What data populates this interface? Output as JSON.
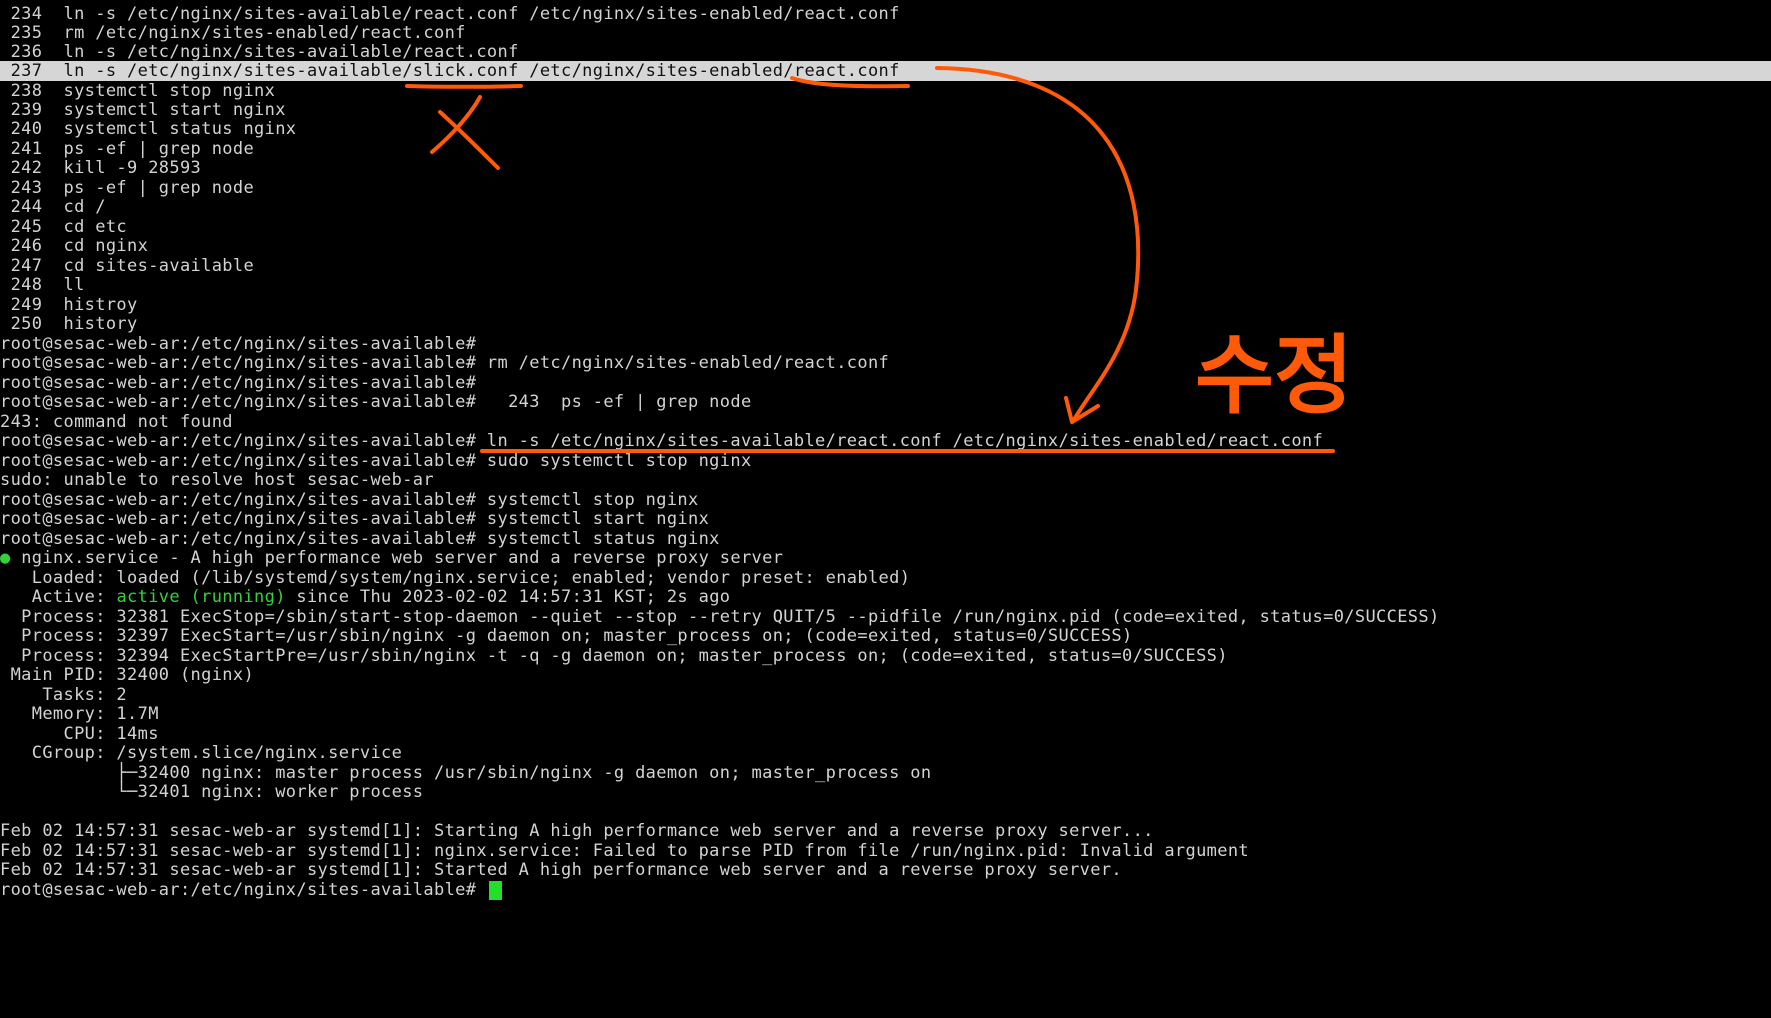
{
  "terminal": {
    "lines": [
      " 234  ln -s /etc/nginx/sites-available/react.conf /etc/nginx/sites-enabled/react.conf",
      " 235  rm /etc/nginx/sites-enabled/react.conf",
      " 236  ln -s /etc/nginx/sites-available/react.conf",
      " 237  ln -s /etc/nginx/sites-available/slick.conf /etc/nginx/sites-enabled/react.conf",
      " 238  systemctl stop nginx",
      " 239  systemctl start nginx",
      " 240  systemctl status nginx",
      " 241  ps -ef | grep node",
      " 242  kill -9 28593",
      " 243  ps -ef | grep node",
      " 244  cd /",
      " 245  cd etc",
      " 246  cd nginx",
      " 247  cd sites-available",
      " 248  ll",
      " 249  histroy",
      " 250  history",
      "root@sesac-web-ar:/etc/nginx/sites-available#",
      "root@sesac-web-ar:/etc/nginx/sites-available# rm /etc/nginx/sites-enabled/react.conf",
      "root@sesac-web-ar:/etc/nginx/sites-available#",
      "root@sesac-web-ar:/etc/nginx/sites-available#   243  ps -ef | grep node",
      "243: command not found",
      "root@sesac-web-ar:/etc/nginx/sites-available# ln -s /etc/nginx/sites-available/react.conf /etc/nginx/sites-enabled/react.conf",
      "root@sesac-web-ar:/etc/nginx/sites-available# sudo systemctl stop nginx",
      "sudo: unable to resolve host sesac-web-ar",
      "root@sesac-web-ar:/etc/nginx/sites-available# systemctl stop nginx",
      "root@sesac-web-ar:/etc/nginx/sites-available# systemctl start nginx",
      "root@sesac-web-ar:/etc/nginx/sites-available# systemctl status nginx",
      "nginx.service - A high performance web server and a reverse proxy server",
      "   Loaded: loaded (/lib/systemd/system/nginx.service; enabled; vendor preset: enabled)",
      "",
      "  Process: 32381 ExecStop=/sbin/start-stop-daemon --quiet --stop --retry QUIT/5 --pidfile /run/nginx.pid (code=exited, status=0/SUCCESS)",
      "  Process: 32397 ExecStart=/usr/sbin/nginx -g daemon on; master_process on; (code=exited, status=0/SUCCESS)",
      "  Process: 32394 ExecStartPre=/usr/sbin/nginx -t -q -g daemon on; master_process on; (code=exited, status=0/SUCCESS)",
      " Main PID: 32400 (nginx)",
      "    Tasks: 2",
      "   Memory: 1.7M",
      "      CPU: 14ms",
      "   CGroup: /system.slice/nginx.service",
      "           ├─32400 nginx: master process /usr/sbin/nginx -g daemon on; master_process on",
      "           └─32401 nginx: worker process",
      "",
      "Feb 02 14:57:31 sesac-web-ar systemd[1]: Starting A high performance web server and a reverse proxy server...",
      "Feb 02 14:57:31 sesac-web-ar systemd[1]: nginx.service: Failed to parse PID from file /run/nginx.pid: Invalid argument",
      "Feb 02 14:57:31 sesac-web-ar systemd[1]: Started A high performance web server and a reverse proxy server.",
      "root@sesac-web-ar:/etc/nginx/sites-available#"
    ],
    "active_line": {
      "prefix": "   Active: ",
      "status": "active (running)",
      "suffix": " since Thu 2023-02-02 14:57:31 KST; 2s ago"
    },
    "service_bullet": "●",
    "colors": {
      "background": "#000000",
      "text": "#d3d3d3",
      "active": "#34d23a",
      "cursor": "#22e02a",
      "highlight": "#d6d6d6",
      "annotation": "#ff5a0a"
    }
  },
  "annotations": {
    "handwritten_note": "수정",
    "strike_mark": "X"
  }
}
